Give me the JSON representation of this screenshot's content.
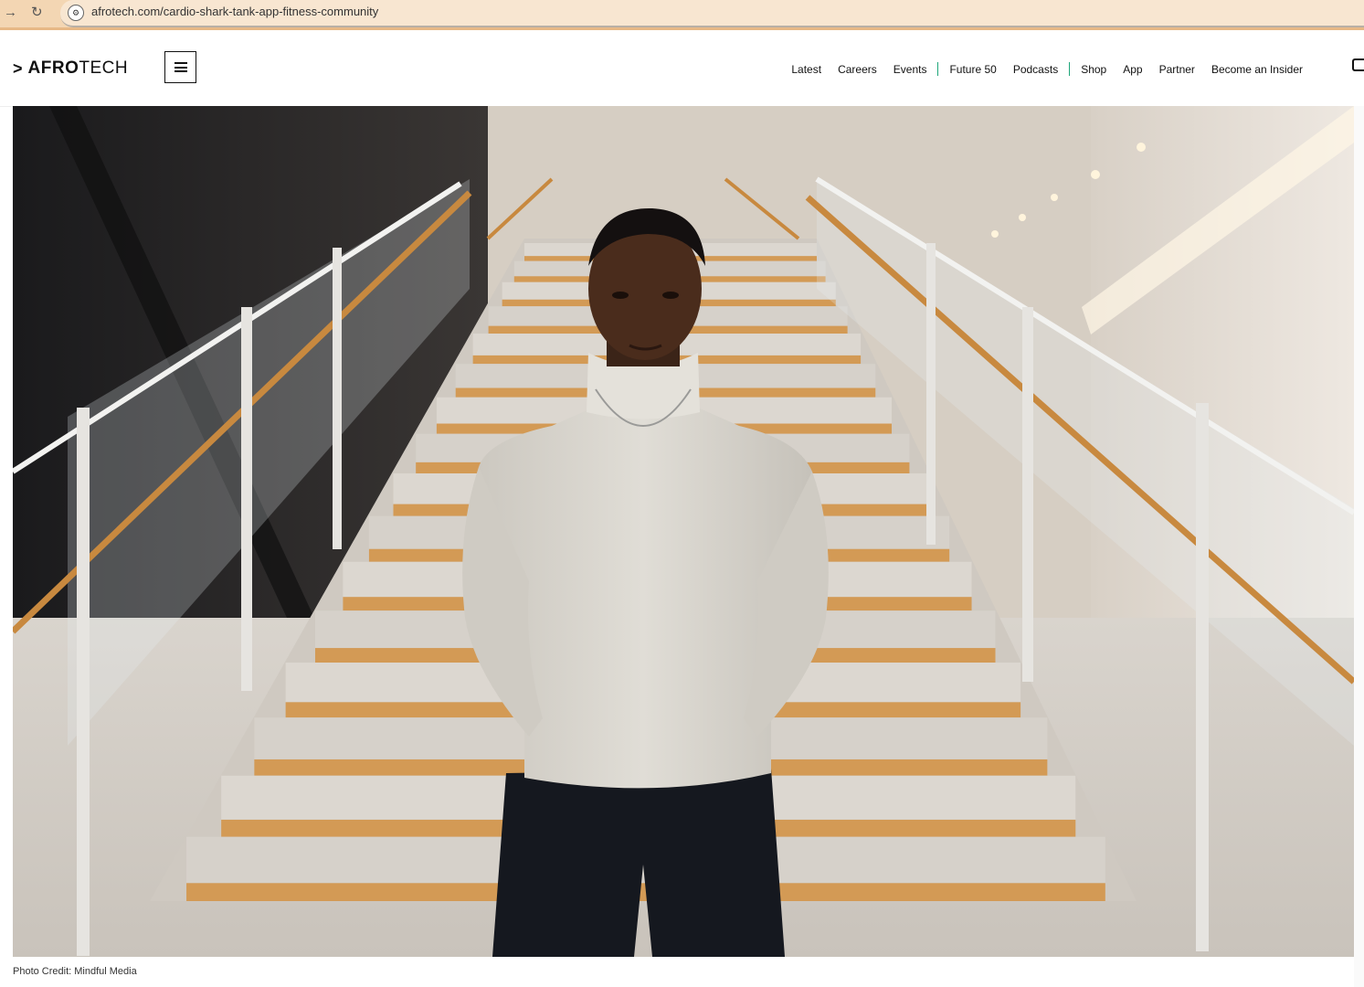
{
  "browser": {
    "url": "afrotech.com/cardio-shark-tank-app-fitness-community",
    "forward_icon": "arrow-right-icon",
    "reload_icon": "reload-icon",
    "site_info_icon": "site-settings-icon"
  },
  "header": {
    "logo_mark": ">",
    "logo_bold": "AFRO",
    "logo_light": "TECH",
    "menu_icon": "hamburger-menu-icon",
    "nav": [
      "Latest",
      "Careers",
      "Events",
      "Future 50",
      "Podcasts",
      "Shop",
      "App",
      "Partner",
      "Become an Insider"
    ],
    "search_icon": "search-icon"
  },
  "hero": {
    "caption": "Photo Credit: Mindful Media"
  },
  "colors": {
    "browser_bar": "#f3d6b3",
    "nav_divider": "#1ea67a",
    "handrail": "#c8893f",
    "stair_edge": "#d39a55"
  }
}
